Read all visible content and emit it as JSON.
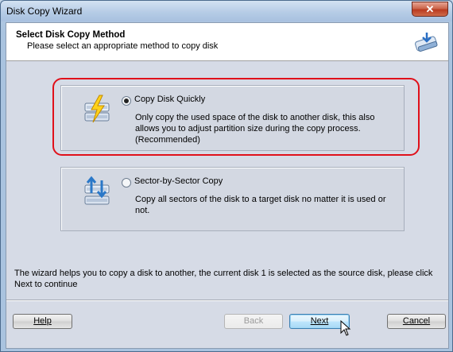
{
  "window": {
    "title": "Disk Copy Wizard",
    "close_label": "✕"
  },
  "header": {
    "title": "Select Disk Copy Method",
    "subtitle": "Please select an appropriate method to copy disk",
    "icon": "disk-copy-icon"
  },
  "options": [
    {
      "label": "Copy Disk Quickly",
      "description": "Only copy the used space of the disk to another disk, this also allows you to adjust partition size during the copy process.(Recommended)",
      "selected": true,
      "icon": "quick-copy-disk-icon"
    },
    {
      "label": "Sector-by-Sector Copy",
      "description": "Copy all sectors of the disk to a target disk no matter it is used or not.",
      "selected": false,
      "icon": "sector-copy-disk-icon"
    }
  ],
  "footer": {
    "info": "The wizard helps you to copy a disk to another, the current disk 1 is selected as the source disk, please click Next to continue"
  },
  "buttons": {
    "help": "Help",
    "back": "Back",
    "next": "Next",
    "cancel": "Cancel"
  },
  "colors": {
    "highlight": "#e0101a",
    "accent": "#3c7fb1"
  }
}
